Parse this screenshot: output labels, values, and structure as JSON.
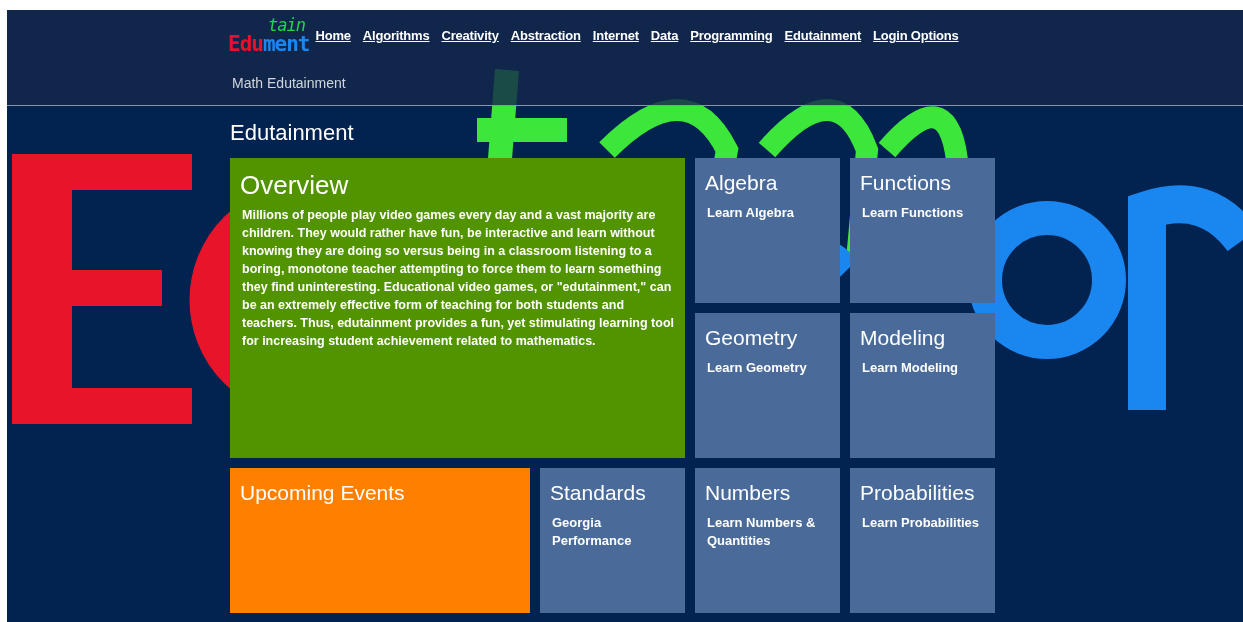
{
  "logo": {
    "parts": [
      {
        "text": "Edu",
        "kind": "base",
        "color": "#e8102a"
      },
      {
        "text": "tain",
        "kind": "raised",
        "color": "#1ed94a"
      },
      {
        "text": "ment",
        "kind": "base",
        "color": "#1a86f0"
      }
    ]
  },
  "nav": [
    "Home",
    "Algorithms",
    "Creativity",
    "Abstraction",
    "Internet",
    "Data",
    "Programming",
    "Edutainment",
    "Login Options"
  ],
  "site_subtitle": "Math Edutainment",
  "page_title": "Edutainment",
  "tiles": [
    {
      "kind": "overview",
      "title": "Overview",
      "body": "Millions of people play video games every day and a vast majority are children. They would rather have fun, be interactive and learn without knowing they are doing so versus being in a classroom listening to a boring, monotone teacher attempting to force them to learn something they find uninteresting. Educational video games, or \"edutainment,\" can be an extremely effective form of teaching for both students and teachers. Thus, edutainment provides a fun, yet stimulating learning tool for increasing student achievement related to mathematics.",
      "color": "#519400"
    },
    {
      "kind": "subject",
      "title": "Algebra",
      "body": "Learn Algebra",
      "color": "#4a6b9a"
    },
    {
      "kind": "subject",
      "title": "Functions",
      "body": "Learn Functions",
      "color": "#4a6b9a"
    },
    {
      "kind": "subject",
      "title": "Geometry",
      "body": "Learn Geometry",
      "color": "#4a6b9a"
    },
    {
      "kind": "subject",
      "title": "Modeling",
      "body": "Learn Modeling",
      "color": "#4a6b9a"
    },
    {
      "kind": "events",
      "title": "Upcoming Events",
      "color": "#ff8000"
    },
    {
      "kind": "subject",
      "title": "Standards",
      "body": "Georgia Performance",
      "color": "#4a6b9a"
    },
    {
      "kind": "subject",
      "title": "Numbers",
      "body": "Learn Numbers & Quantities",
      "color": "#4a6b9a"
    },
    {
      "kind": "subject",
      "title": "Probabilities",
      "body": "Learn Probabilities",
      "color": "#4a6b9a"
    }
  ]
}
